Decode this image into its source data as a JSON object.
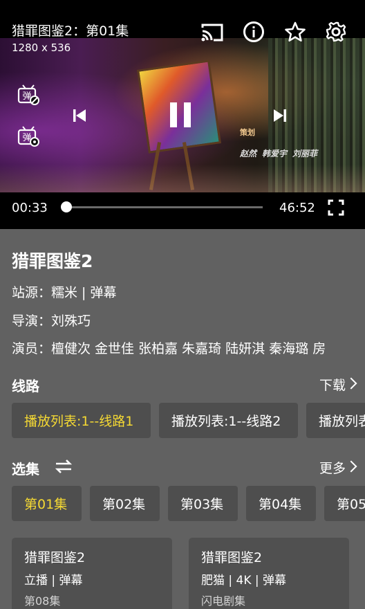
{
  "player": {
    "title": "猎罪图鉴2：第01集",
    "resolution": "1280 x 536",
    "current_time": "00:33",
    "total_time": "46:52",
    "progress_fraction": 0.012,
    "credits_role": "策划",
    "credits_names": [
      "赵然",
      "韩爱宇",
      "刘丽菲"
    ],
    "icons": {
      "cast": "cast-icon",
      "info": "info-icon",
      "favorite": "star-icon",
      "settings": "gear-icon",
      "danmaku_off": "danmaku-off-icon",
      "danmaku_settings": "danmaku-settings-icon",
      "prev": "skip-previous-icon",
      "pause": "pause-icon",
      "next": "skip-next-icon",
      "fullscreen": "fullscreen-icon"
    }
  },
  "details": {
    "title": "猎罪图鉴2",
    "source": "站源：糯米 | 弹幕",
    "director": "导演：刘殊巧",
    "cast": "演员：檀健次 金世佳 张柏嘉 朱嘉琦 陆妍淇 秦海璐 房"
  },
  "routes": {
    "title": "线路",
    "download_label": "下载",
    "items": [
      "播放列表:1--线路1",
      "播放列表:1--线路2",
      "播放列表"
    ]
  },
  "episodes": {
    "title": "选集",
    "more_label": "更多",
    "items": [
      "第01集",
      "第02集",
      "第03集",
      "第04集",
      "第05"
    ]
  },
  "related": [
    {
      "title": "猎罪图鉴2",
      "source": "立播 | 弹幕",
      "meta": "第08集"
    },
    {
      "title": "猎罪图鉴2",
      "source": "肥猫 | 4K | 弹幕",
      "meta": "闪电剧集"
    }
  ],
  "colors": {
    "accent": "#f5d933",
    "background": "#616161",
    "chip": "#4e4e4e"
  }
}
